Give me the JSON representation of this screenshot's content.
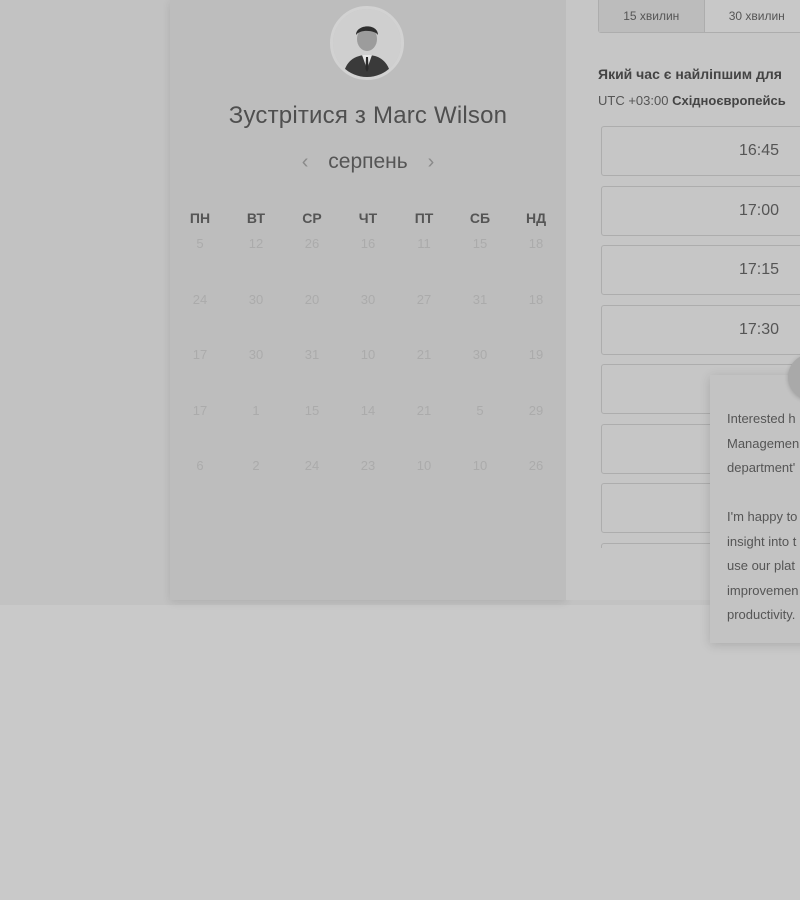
{
  "duration_tabs": [
    "15 хвилин",
    "30 хвилин"
  ],
  "host": {
    "title": "Зустрітися з Marc Wilson",
    "avatar_icon": "person-avatar-icon"
  },
  "calendar": {
    "month": "серпень",
    "prev_icon": "chevron-left-icon",
    "next_icon": "chevron-right-icon",
    "weekdays": [
      "ПН",
      "ВТ",
      "СР",
      "ЧТ",
      "ПТ",
      "СБ",
      "НД"
    ],
    "weeks": [
      [
        "5",
        "12",
        "26",
        "16",
        "11",
        "15",
        "18"
      ],
      [
        "24",
        "30",
        "20",
        "30",
        "27",
        "31",
        "18"
      ],
      [
        "17",
        "30",
        "31",
        "10",
        "21",
        "30",
        "19"
      ],
      [
        "17",
        "1",
        "15",
        "14",
        "21",
        "5",
        "29"
      ],
      [
        "6",
        "2",
        "24",
        "23",
        "10",
        "10",
        "26"
      ]
    ]
  },
  "booking": {
    "question": "Який час є найліпшим для",
    "tz_offset": "UTC +03:00",
    "tz_name": "Східноєвропейсь",
    "slots": [
      "16:45",
      "17:00",
      "17:15",
      "17:30",
      "",
      "",
      "",
      ""
    ]
  },
  "popup": {
    "lines_a": [
      "Interested h",
      "Managemen",
      "department'"
    ],
    "lines_b": [
      "I'm happy to",
      "insight into t",
      "use our plat",
      "improvemen",
      "productivity."
    ]
  }
}
